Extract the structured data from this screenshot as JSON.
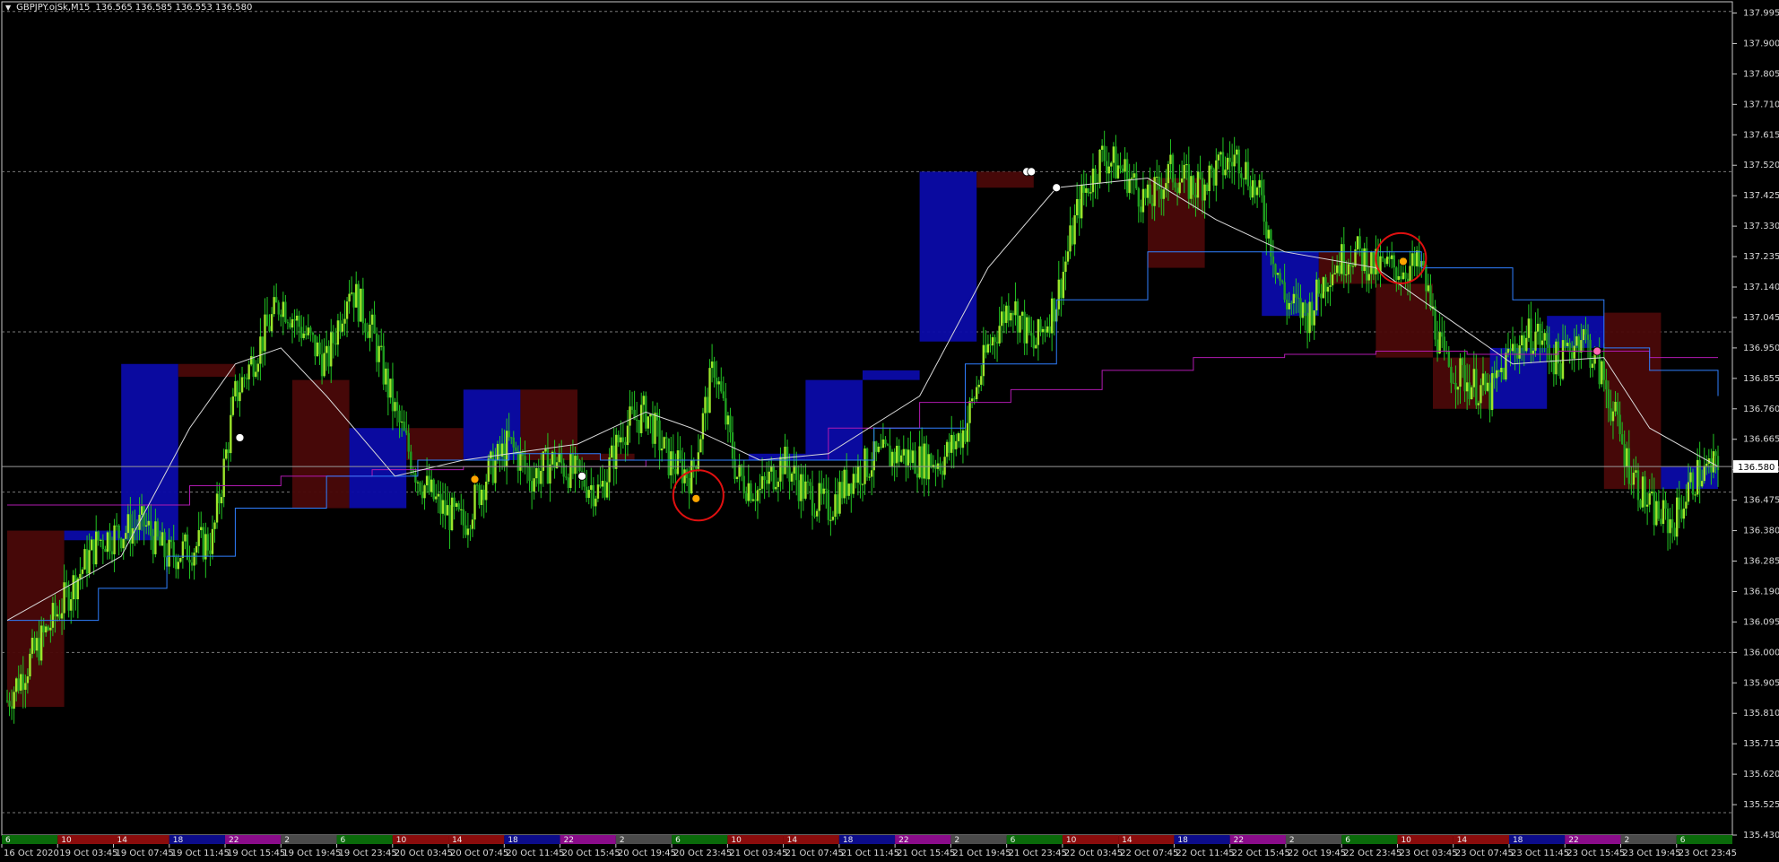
{
  "header": {
    "symbol_timeframe": "GBPJPY.ojSk,M15",
    "ohlc": "136.565 136.585 136.553 136.580",
    "menu_icon": "triangle-down-icon"
  },
  "current_price": "136.580",
  "chart_data": {
    "type": "candlestick",
    "symbol": "GBPJPY.ojSk",
    "timeframe": "M15",
    "ylim": [
      135.43,
      138.03
    ],
    "y_ticks": [
      "137.995",
      "137.900",
      "137.805",
      "137.710",
      "137.615",
      "137.520",
      "137.425",
      "137.330",
      "137.235",
      "137.140",
      "137.045",
      "136.950",
      "136.855",
      "136.760",
      "136.665",
      "136.570",
      "136.475",
      "136.380",
      "136.285",
      "136.190",
      "136.095",
      "136.000",
      "135.905",
      "135.810",
      "135.715",
      "135.620",
      "135.525",
      "135.430"
    ],
    "x_labels": [
      "16 Oct 2020",
      "19 Oct 03:45",
      "19 Oct 07:45",
      "19 Oct 11:45",
      "19 Oct 15:45",
      "19 Oct 19:45",
      "19 Oct 23:45",
      "20 Oct 03:45",
      "20 Oct 07:45",
      "20 Oct 11:45",
      "20 Oct 15:45",
      "20 Oct 19:45",
      "20 Oct 23:45",
      "21 Oct 03:45",
      "21 Oct 07:45",
      "21 Oct 11:45",
      "21 Oct 15:45",
      "21 Oct 19:45",
      "21 Oct 23:45",
      "22 Oct 03:45",
      "22 Oct 07:45",
      "22 Oct 11:45",
      "22 Oct 15:45",
      "22 Oct 19:45",
      "22 Oct 23:45",
      "23 Oct 03:45",
      "23 Oct 07:45",
      "23 Oct 11:45",
      "23 Oct 15:45",
      "23 Oct 19:45",
      "23 Oct 23:45"
    ],
    "hour_strip": [
      "6",
      "10",
      "14",
      "18",
      "22",
      "2",
      "6",
      "10",
      "14",
      "18",
      "22",
      "2",
      "6",
      "10",
      "14",
      "18",
      "22",
      "2",
      "6",
      "10",
      "14",
      "18",
      "22",
      "2",
      "6",
      "10",
      "14",
      "18",
      "22",
      "2",
      "6"
    ],
    "hour_strip_colors": [
      "#0a6a0a",
      "#8a0c0c",
      "#8a0c0c",
      "#0c0c8a",
      "#8a0c8a",
      "#4a4a4a",
      "#0a6a0a",
      "#8a0c0c",
      "#8a0c0c",
      "#0c0c8a",
      "#8a0c8a",
      "#4a4a4a",
      "#0a6a0a",
      "#8a0c0c",
      "#8a0c0c",
      "#0c0c8a",
      "#8a0c8a",
      "#4a4a4a",
      "#0a6a0a",
      "#8a0c0c",
      "#8a0c0c",
      "#0c0c8a",
      "#8a0c8a",
      "#4a4a4a",
      "#0a6a0a",
      "#8a0c0c",
      "#8a0c0c",
      "#0c0c8a",
      "#8a0c8a",
      "#4a4a4a",
      "#0a6a0a"
    ],
    "dashed_levels": [
      138.0,
      137.5,
      137.0,
      136.5,
      136.0,
      135.5
    ],
    "current_price_value": 136.58,
    "price_path": [
      [
        0,
        135.85
      ],
      [
        2,
        136.1
      ],
      [
        4,
        136.35
      ],
      [
        6,
        136.4
      ],
      [
        7,
        136.3
      ],
      [
        9,
        136.35
      ],
      [
        10,
        136.8
      ],
      [
        11,
        136.95
      ],
      [
        12,
        137.1
      ],
      [
        13,
        137.0
      ],
      [
        14,
        136.9
      ],
      [
        15,
        137.15
      ],
      [
        16,
        137.0
      ],
      [
        17,
        136.75
      ],
      [
        18,
        136.55
      ],
      [
        19,
        136.45
      ],
      [
        20,
        136.4
      ],
      [
        21,
        136.55
      ],
      [
        22,
        136.65
      ],
      [
        23,
        136.55
      ],
      [
        24,
        136.6
      ],
      [
        25,
        136.55
      ],
      [
        26,
        136.5
      ],
      [
        27,
        136.7
      ],
      [
        28,
        136.75
      ],
      [
        29,
        136.6
      ],
      [
        30,
        136.55
      ],
      [
        31,
        136.9
      ],
      [
        32,
        136.55
      ],
      [
        33,
        136.5
      ],
      [
        34,
        136.6
      ],
      [
        35,
        136.5
      ],
      [
        36,
        136.45
      ],
      [
        37,
        136.55
      ],
      [
        38,
        136.6
      ],
      [
        39,
        136.62
      ],
      [
        40,
        136.6
      ],
      [
        41,
        136.6
      ],
      [
        42,
        136.7
      ],
      [
        43,
        136.95
      ],
      [
        44,
        137.1
      ],
      [
        45,
        136.95
      ],
      [
        46,
        137.1
      ],
      [
        47,
        137.4
      ],
      [
        48,
        137.55
      ],
      [
        49,
        137.5
      ],
      [
        50,
        137.4
      ],
      [
        51,
        137.5
      ],
      [
        52,
        137.45
      ],
      [
        53,
        137.5
      ],
      [
        54,
        137.55
      ],
      [
        55,
        137.4
      ],
      [
        56,
        137.1
      ],
      [
        57,
        137.05
      ],
      [
        58,
        137.2
      ],
      [
        59,
        137.25
      ],
      [
        60,
        137.2
      ],
      [
        61,
        137.2
      ],
      [
        62,
        137.2
      ],
      [
        63,
        136.9
      ],
      [
        64,
        136.85
      ],
      [
        65,
        136.8
      ],
      [
        66,
        136.95
      ],
      [
        67,
        137.0
      ],
      [
        68,
        136.9
      ],
      [
        69,
        137.0
      ],
      [
        70,
        136.85
      ],
      [
        71,
        136.6
      ],
      [
        72,
        136.45
      ],
      [
        73,
        136.4
      ],
      [
        74,
        136.55
      ],
      [
        75,
        136.58
      ]
    ],
    "candle_count": 76,
    "period_boxes": [
      {
        "start": 0,
        "end": 2.5,
        "open": 136.38,
        "close": 135.83,
        "low": 135.83,
        "high": 136.38,
        "bull": false
      },
      {
        "start": 2.5,
        "end": 5,
        "open": 136.35,
        "close": 136.38,
        "low": 136.3,
        "high": 136.42,
        "bull": true
      },
      {
        "start": 5,
        "end": 7.5,
        "open": 136.35,
        "close": 136.9,
        "low": 136.35,
        "high": 136.9,
        "bull": true
      },
      {
        "start": 7.5,
        "end": 10,
        "open": 136.9,
        "close": 136.86,
        "low": 136.86,
        "high": 136.9,
        "bull": false
      },
      {
        "start": 12.5,
        "end": 15,
        "open": 136.85,
        "close": 136.45,
        "low": 136.45,
        "high": 136.85,
        "bull": false
      },
      {
        "start": 15,
        "end": 17.5,
        "open": 136.45,
        "close": 136.7,
        "low": 136.45,
        "high": 136.7,
        "bull": true
      },
      {
        "start": 17.5,
        "end": 20,
        "open": 136.7,
        "close": 136.6,
        "low": 136.6,
        "high": 136.7,
        "bull": false
      },
      {
        "start": 20,
        "end": 22.5,
        "open": 136.6,
        "close": 136.82,
        "low": 136.6,
        "high": 136.82,
        "bull": true
      },
      {
        "start": 22.5,
        "end": 25,
        "open": 136.82,
        "close": 136.6,
        "low": 136.6,
        "high": 136.82,
        "bull": false
      },
      {
        "start": 25,
        "end": 27.5,
        "open": 136.6,
        "close": 136.62,
        "low": 136.6,
        "high": 136.62,
        "bull": false
      },
      {
        "start": 32.5,
        "end": 35,
        "open": 136.6,
        "close": 136.62,
        "low": 136.57,
        "high": 136.65,
        "bull": true
      },
      {
        "start": 35,
        "end": 37.5,
        "open": 136.6,
        "close": 136.85,
        "low": 136.6,
        "high": 136.85,
        "bull": true
      },
      {
        "start": 37.5,
        "end": 40,
        "open": 136.85,
        "close": 136.88,
        "low": 136.85,
        "high": 136.88,
        "bull": true
      },
      {
        "start": 40,
        "end": 42.5,
        "open": 136.97,
        "close": 137.5,
        "low": 136.97,
        "high": 137.5,
        "bull": true
      },
      {
        "start": 42.5,
        "end": 45,
        "open": 137.5,
        "close": 137.45,
        "low": 137.45,
        "high": 137.5,
        "bull": false
      },
      {
        "start": 50,
        "end": 52.5,
        "open": 137.48,
        "close": 137.2,
        "low": 137.2,
        "high": 137.48,
        "bull": false
      },
      {
        "start": 55,
        "end": 57.5,
        "open": 137.05,
        "close": 137.25,
        "low": 137.05,
        "high": 137.25,
        "bull": true
      },
      {
        "start": 57.5,
        "end": 60,
        "open": 137.25,
        "close": 137.15,
        "low": 137.15,
        "high": 137.25,
        "bull": false
      },
      {
        "start": 60,
        "end": 62.5,
        "open": 137.15,
        "close": 136.92,
        "low": 136.92,
        "high": 137.15,
        "bull": false
      },
      {
        "start": 62.5,
        "end": 65,
        "open": 136.92,
        "close": 136.76,
        "low": 136.76,
        "high": 136.92,
        "bull": false
      },
      {
        "start": 65,
        "end": 67.5,
        "open": 136.76,
        "close": 136.95,
        "low": 136.76,
        "high": 136.95,
        "bull": true
      },
      {
        "start": 67.5,
        "end": 70,
        "open": 136.95,
        "close": 137.05,
        "low": 136.95,
        "high": 137.05,
        "bull": true
      },
      {
        "start": 70,
        "end": 72.5,
        "open": 137.06,
        "close": 136.51,
        "low": 136.51,
        "high": 137.06,
        "bull": false
      },
      {
        "start": 72.5,
        "end": 75,
        "open": 136.51,
        "close": 136.58,
        "low": 136.51,
        "high": 136.58,
        "bull": true
      }
    ],
    "ma_fast": [
      [
        0,
        136.1
      ],
      [
        5,
        136.3
      ],
      [
        8,
        136.7
      ],
      [
        10,
        136.9
      ],
      [
        12,
        136.95
      ],
      [
        14,
        136.8
      ],
      [
        17,
        136.55
      ],
      [
        20,
        136.6
      ],
      [
        25,
        136.65
      ],
      [
        28,
        136.75
      ],
      [
        30,
        136.7
      ],
      [
        33,
        136.6
      ],
      [
        36,
        136.62
      ],
      [
        40,
        136.8
      ],
      [
        43,
        137.2
      ],
      [
        46,
        137.45
      ],
      [
        50,
        137.48
      ],
      [
        53,
        137.35
      ],
      [
        56,
        137.25
      ],
      [
        60,
        137.2
      ],
      [
        63,
        137.05
      ],
      [
        66,
        136.9
      ],
      [
        70,
        136.92
      ],
      [
        72,
        136.7
      ],
      [
        75,
        136.58
      ]
    ],
    "ma_slow": [
      [
        0,
        136.1
      ],
      [
        4,
        136.2
      ],
      [
        7,
        136.3
      ],
      [
        10,
        136.45
      ],
      [
        14,
        136.55
      ],
      [
        18,
        136.6
      ],
      [
        22,
        136.62
      ],
      [
        26,
        136.6
      ],
      [
        30,
        136.6
      ],
      [
        34,
        136.6
      ],
      [
        38,
        136.7
      ],
      [
        42,
        136.9
      ],
      [
        46,
        137.1
      ],
      [
        50,
        137.25
      ],
      [
        54,
        137.25
      ],
      [
        58,
        137.25
      ],
      [
        62,
        137.2
      ],
      [
        66,
        137.1
      ],
      [
        70,
        136.95
      ],
      [
        72,
        136.88
      ],
      [
        75,
        136.8
      ]
    ],
    "ma_long": [
      [
        0,
        136.46
      ],
      [
        4,
        136.46
      ],
      [
        8,
        136.52
      ],
      [
        12,
        136.55
      ],
      [
        16,
        136.57
      ],
      [
        20,
        136.58
      ],
      [
        24,
        136.58
      ],
      [
        28,
        136.6
      ],
      [
        32,
        136.6
      ],
      [
        36,
        136.7
      ],
      [
        40,
        136.78
      ],
      [
        44,
        136.82
      ],
      [
        48,
        136.88
      ],
      [
        52,
        136.92
      ],
      [
        56,
        136.93
      ],
      [
        60,
        136.94
      ],
      [
        64,
        136.93
      ],
      [
        68,
        136.94
      ],
      [
        72,
        136.92
      ],
      [
        75,
        136.92
      ]
    ],
    "signal_markers": [
      {
        "i": 10.2,
        "price": 136.67,
        "color": "#ffffff"
      },
      {
        "i": 20.5,
        "price": 136.54,
        "color": "#ffa500"
      },
      {
        "i": 25.2,
        "price": 136.55,
        "color": "#ffffff"
      },
      {
        "i": 30.2,
        "price": 136.48,
        "color": "#ffa500"
      },
      {
        "i": 44.7,
        "price": 137.5,
        "color": "#ffffff"
      },
      {
        "i": 44.9,
        "price": 137.5,
        "color": "#ffffff"
      },
      {
        "i": 46,
        "price": 137.45,
        "color": "#ffffff"
      },
      {
        "i": 61.2,
        "price": 137.22,
        "color": "#ffa500"
      },
      {
        "i": 69.7,
        "price": 136.94,
        "color": "#ff69b4"
      }
    ],
    "highlight_circles": [
      {
        "i": 30.3,
        "price": 136.49
      },
      {
        "i": 61.1,
        "price": 137.23
      }
    ]
  }
}
